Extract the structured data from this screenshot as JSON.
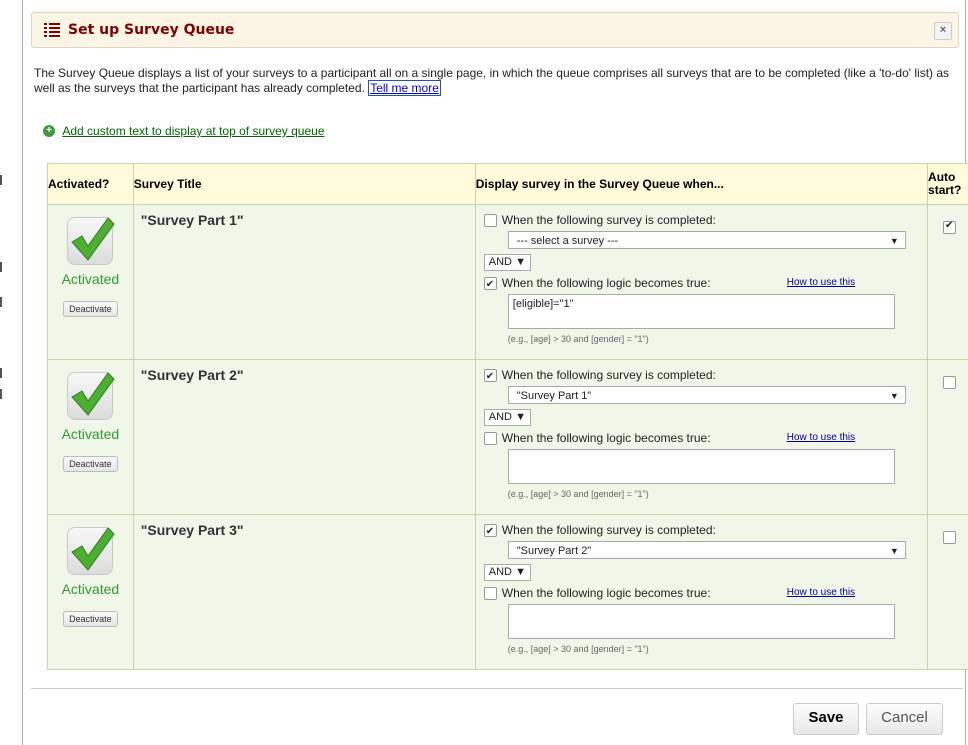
{
  "dialog": {
    "title": "Set up Survey Queue",
    "close_label": "×",
    "intro_text": "The Survey Queue displays a list of your surveys to a participant all on a single page, in which the queue comprises all surveys that are to be completed (like a 'to-do' list) as well as the surveys that the participant has already completed.",
    "tell_me_more": "Tell me more",
    "add_custom_text": "Add custom text to display at top of survey queue"
  },
  "table": {
    "headers": {
      "activated": "Activated?",
      "survey_title": "Survey Title",
      "display_when": "Display survey in the Survey Queue when...",
      "auto_start_1": "Auto",
      "auto_start_2": "start?"
    },
    "rows": [
      {
        "status": "Activated",
        "deactivate": "Deactivate",
        "title": "\"Survey Part 1\"",
        "survey_completed_label": "When the following survey is completed:",
        "survey_completed_checked": false,
        "selected_survey": "--- select a survey ---",
        "operator": "AND",
        "logic_label": "When the following logic becomes true:",
        "logic_checked": true,
        "how_to": "How to use this",
        "logic_value": "[eligible]=\"1\"",
        "example": "(e.g., [age] > 30 and [gender] = \"1\")",
        "auto_start": true
      },
      {
        "status": "Activated",
        "deactivate": "Deactivate",
        "title": "\"Survey Part 2\"",
        "survey_completed_label": "When the following survey is completed:",
        "survey_completed_checked": true,
        "selected_survey": "\"Survey Part 1\"",
        "operator": "AND",
        "logic_label": "When the following logic becomes true:",
        "logic_checked": false,
        "how_to": "How to use this",
        "logic_value": "",
        "example": "(e.g., [age] > 30 and [gender] = \"1\")",
        "auto_start": false
      },
      {
        "status": "Activated",
        "deactivate": "Deactivate",
        "title": "\"Survey Part 3\"",
        "survey_completed_label": "When the following survey is completed:",
        "survey_completed_checked": true,
        "selected_survey": "\"Survey Part 2\"",
        "operator": "AND",
        "logic_label": "When the following logic becomes true:",
        "logic_checked": false,
        "how_to": "How to use this",
        "logic_value": "",
        "example": "(e.g., [age] > 30 and [gender] = \"1\")",
        "auto_start": false
      }
    ]
  },
  "footer": {
    "save": "Save",
    "cancel": "Cancel"
  },
  "colors": {
    "title": "#800000",
    "activated": "#339933",
    "row_bg": "#f1f7e8",
    "header_bg": "#fffbdb"
  }
}
